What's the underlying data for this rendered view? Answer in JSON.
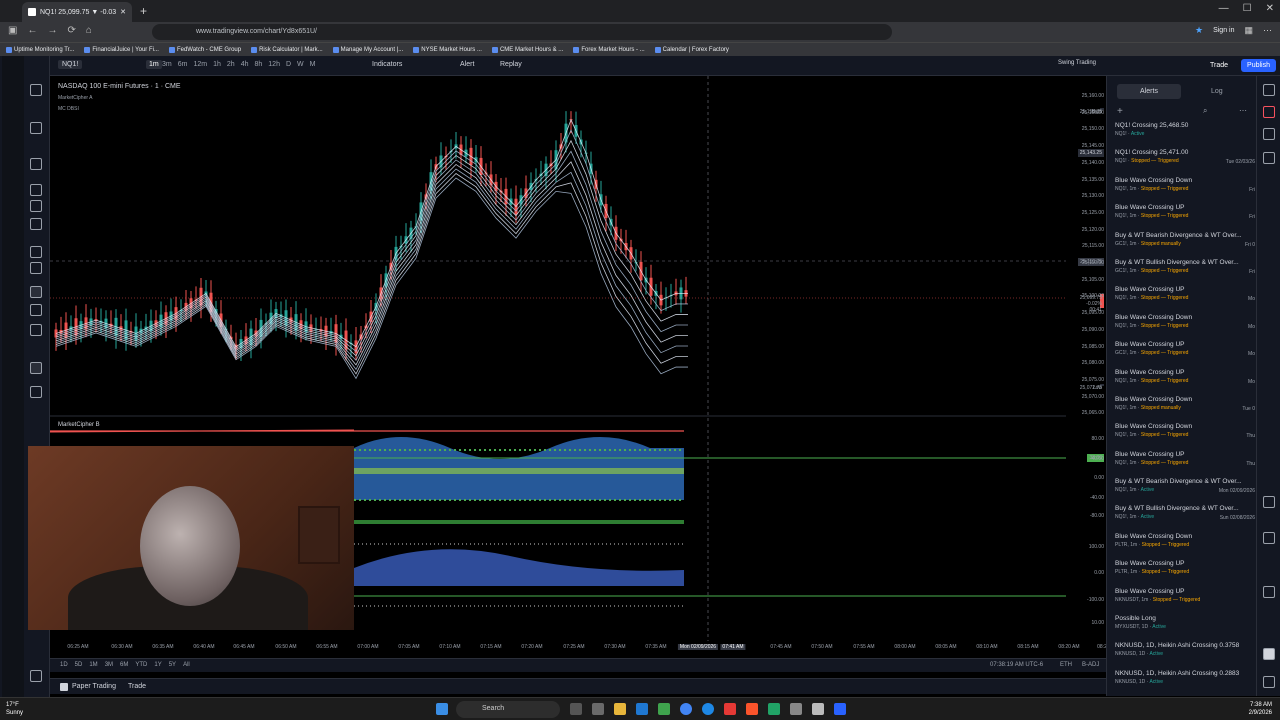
{
  "browser": {
    "tab_title": "NQ1! 25,099.75 ▼ -0.03% Swi",
    "url": "www.tradingview.com/chart/Yd8x651U/",
    "signin": "Sign in",
    "bookmarks": [
      "Uptime Monitoring Tr...",
      "FinancialJuice | Your Fi...",
      "FedWatch - CME Group",
      "Risk Calculator | Mark...",
      "Manage My Account |...",
      "NYSE Market Hours ...",
      "CME Market Hours & ...",
      "Forex Market Hours - ...",
      "Calendar | Forex Factory"
    ]
  },
  "toolbar": {
    "symbol": "NQ1!",
    "interval": "1m",
    "indicators": "Indicators",
    "alert": "Alert",
    "replay": "Replay",
    "layout": "Swing Trading",
    "trade": "Trade",
    "publish": "Publish",
    "more_intervals": [
      "3m",
      "6m",
      "12m",
      "1h",
      "2h",
      "4h",
      "8h",
      "12h",
      "D",
      "W",
      "M"
    ]
  },
  "chart": {
    "title": "NASDAQ 100 E-mini Futures · 1 · CME",
    "indicator1": "MarketCipher A",
    "indicator2": "MC DBSI",
    "panel_title": "MarketCipher B",
    "price_ticks": [
      "25,160.00",
      "25,155.00",
      "25,150.00",
      "25,145.00",
      "25,140.00",
      "25,135.00",
      "25,130.00",
      "25,125.00",
      "25,120.00",
      "25,115.00",
      "25,110.00",
      "25,105.00",
      "25,100.00",
      "25,095.00",
      "25,090.00",
      "25,085.00",
      "25,080.00",
      "25,075.00",
      "25,070.00",
      "25,065.00"
    ],
    "high_label": "High",
    "high_value": "25,155.75",
    "cursor_price": "25,110.75",
    "current_price": "25,099.75",
    "current_change": "-0.02%",
    "current_time": "00:41",
    "low_label": "Low",
    "low_value": "25,072.75",
    "prev_price": "25,143.25",
    "osc_ticks": [
      "80.00",
      "40.00",
      "0.00",
      "-40.00",
      "-80.00",
      "100.00",
      "0.00",
      "-100.00",
      "10.00"
    ],
    "osc_label": "38.80",
    "time_ticks": [
      "06:25 AM",
      "06:30 AM",
      "06:35 AM",
      "06:40 AM",
      "06:45 AM",
      "06:50 AM",
      "06:55 AM",
      "07:00 AM",
      "07:05 AM",
      "07:10 AM",
      "07:15 AM",
      "07:20 AM",
      "07:25 AM",
      "07:30 AM",
      "07:35 AM",
      "Mon 02/09/2026",
      "07:41 AM",
      "07:45 AM",
      "07:50 AM",
      "07:55 AM",
      "08:00 AM",
      "08:05 AM",
      "08:10 AM",
      "08:15 AM",
      "08:20 AM",
      "08:2"
    ],
    "timeframes": [
      "1D",
      "5D",
      "1M",
      "3M",
      "6M",
      "YTD",
      "1Y",
      "5Y",
      "All"
    ],
    "status": "07:38:19 AM UTC-6",
    "session": "ETH",
    "badj": "B-ADJ",
    "paper": "Paper Trading",
    "trade_tab": "Trade"
  },
  "alerts_panel": {
    "alerts_tab": "Alerts",
    "log_tab": "Log",
    "items": [
      {
        "title": "NQ1! Crossing 25,468.50",
        "sub": "NQ1!",
        "state": "Active",
        "date": ""
      },
      {
        "title": "NQ1! Crossing 25,471.00",
        "sub": "NQ1!",
        "state": "Stopped — Triggered",
        "date": "Tue 02/03/26"
      },
      {
        "title": "Blue Wave Crossing Down",
        "sub": "NQ1!, 1m",
        "state": "Stopped — Triggered",
        "date": "Fri"
      },
      {
        "title": "Blue Wave Crossing UP",
        "sub": "NQ1!, 1m",
        "state": "Stopped — Triggered",
        "date": "Fri"
      },
      {
        "title": "Buy & WT Bearish Divergence & WT Over...",
        "sub": "GC1!, 1m",
        "state": "Stopped manually",
        "date": "Fri 0"
      },
      {
        "title": "Buy & WT Bullish Divergence & WT Over...",
        "sub": "GC1!, 1m",
        "state": "Stopped — Triggered",
        "date": "Fri"
      },
      {
        "title": "Blue Wave Crossing UP",
        "sub": "NQ1!, 1m",
        "state": "Stopped — Triggered",
        "date": "Mo"
      },
      {
        "title": "Blue Wave Crossing Down",
        "sub": "NQ1!, 1m",
        "state": "Stopped — Triggered",
        "date": "Mo"
      },
      {
        "title": "Blue Wave Crossing UP",
        "sub": "GC1!, 1m",
        "state": "Stopped — Triggered",
        "date": "Mo"
      },
      {
        "title": "Blue Wave Crossing UP",
        "sub": "NQ1!, 1m",
        "state": "Stopped — Triggered",
        "date": "Mo"
      },
      {
        "title": "Blue Wave Crossing Down",
        "sub": "NQ1!, 1m",
        "state": "Stopped manually",
        "date": "Tue 0"
      },
      {
        "title": "Blue Wave Crossing Down",
        "sub": "NQ1!, 1m",
        "state": "Stopped — Triggered",
        "date": "Thu"
      },
      {
        "title": "Blue Wave Crossing UP",
        "sub": "NQ1!, 1m",
        "state": "Stopped — Triggered",
        "date": "Thu"
      },
      {
        "title": "Buy & WT Bearish Divergence & WT Over...",
        "sub": "NQ1!, 1m",
        "state": "Active",
        "date": "Mon 02/09/2026"
      },
      {
        "title": "Buy & WT Bullish Divergence & WT Over...",
        "sub": "NQ1!, 1m",
        "state": "Active",
        "date": "Sun 02/08/2026"
      },
      {
        "title": "Blue Wave Crossing Down",
        "sub": "PLTR, 1m",
        "state": "Stopped — Triggered",
        "date": ""
      },
      {
        "title": "Blue Wave Crossing UP",
        "sub": "PLTR, 1m",
        "state": "Stopped — Triggered",
        "date": ""
      },
      {
        "title": "Blue Wave Crossing UP",
        "sub": "NKNUSDT, 1m",
        "state": "Stopped — Triggered",
        "date": ""
      },
      {
        "title": "Possible Long",
        "sub": "MYXUSDT, 1D",
        "state": "Active",
        "date": ""
      },
      {
        "title": "NKNUSD, 1D, Heikin Ashi Crossing 0.3758",
        "sub": "NKNUSD, 1D",
        "state": "Active",
        "date": ""
      },
      {
        "title": "NKNUSD, 1D, Heikin Ashi Crossing 0.2883",
        "sub": "NKNUSD, 1D",
        "state": "Active",
        "date": ""
      }
    ]
  },
  "taskbar": {
    "search": "Search",
    "temp": "17°F",
    "weather": "Sunny",
    "time": "7:38 AM",
    "date": "2/9/2026"
  },
  "colors": {
    "up": "#26a69a",
    "down": "#ef5350",
    "bg": "#000000",
    "panel": "#131722",
    "accent": "#2962ff"
  }
}
